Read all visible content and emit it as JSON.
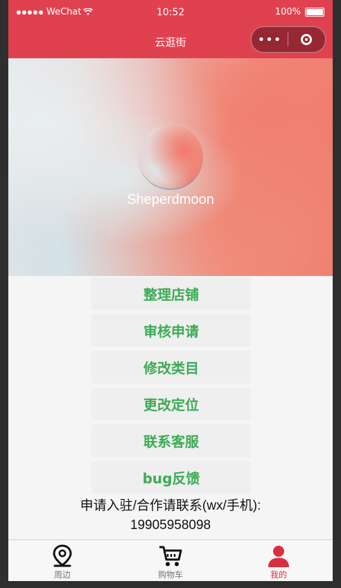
{
  "status_bar": {
    "carrier": "WeChat",
    "time": "10:52",
    "battery": "100%"
  },
  "nav": {
    "title": "云逛街",
    "more_icon": "more-dots-icon",
    "close_icon": "target-close-icon"
  },
  "profile": {
    "username": "Sheperdmoon"
  },
  "menu": {
    "items": [
      {
        "label": "整理店铺"
      },
      {
        "label": "审核申请"
      },
      {
        "label": "修改类目"
      },
      {
        "label": "更改定位"
      },
      {
        "label": "联系客服"
      },
      {
        "label": "bug反馈"
      }
    ]
  },
  "contact": {
    "line1": "申请入驻/合作请联系(wx/手机):",
    "line2": "19905958098"
  },
  "tabs": [
    {
      "label": "周边",
      "icon": "location-pin-icon",
      "active": false
    },
    {
      "label": "购物车",
      "icon": "shopping-cart-icon",
      "active": false
    },
    {
      "label": "我的",
      "icon": "user-profile-icon",
      "active": true
    }
  ],
  "colors": {
    "brand_red": "#e0414f",
    "menu_green": "#3cab55",
    "active_tab": "#d9303e"
  }
}
